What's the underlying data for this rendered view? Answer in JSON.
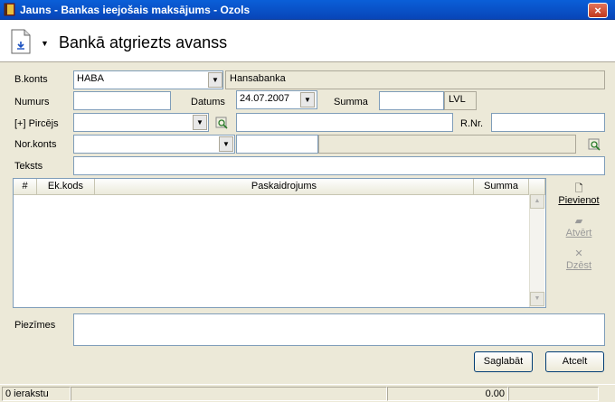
{
  "window": {
    "title": "Jauns - Bankas ieejošais maksājums - Ozols",
    "close": "×"
  },
  "header": {
    "title": "Bankā atgriezts avanss",
    "menu_arrow": "▼"
  },
  "form": {
    "bkonts": {
      "label": "B.konts",
      "value": "HABA",
      "name": "Hansabanka"
    },
    "numurs": {
      "label": "Numurs",
      "value": ""
    },
    "datums": {
      "label": "Datums",
      "value": "24.07.2007"
    },
    "summa": {
      "label": "Summa",
      "value": "",
      "currency": "LVL"
    },
    "pircejs": {
      "label": "[+] Pircējs",
      "value": "",
      "name": ""
    },
    "rnr": {
      "label": "R.Nr.",
      "value": ""
    },
    "norkonts": {
      "label": "Nor.konts",
      "value": "",
      "code": "",
      "name": ""
    },
    "teksts": {
      "label": "Teksts",
      "value": ""
    }
  },
  "grid": {
    "columns": [
      "#",
      "Ek.kods",
      "Paskaidrojums",
      "Summa"
    ],
    "rows": []
  },
  "side_actions": [
    {
      "label": "Pievienot",
      "icon": "new-page-icon",
      "enabled": true
    },
    {
      "label": "Atvērt",
      "icon": "open-folder-icon",
      "enabled": false
    },
    {
      "label": "Dzēst",
      "icon": "delete-x-icon",
      "enabled": false
    }
  ],
  "piezimes": {
    "label": "Piezīmes",
    "value": ""
  },
  "buttons": {
    "save": "Saglabāt",
    "cancel": "Atcelt"
  },
  "status": {
    "records": "0 ierakstu",
    "total": "0.00"
  }
}
